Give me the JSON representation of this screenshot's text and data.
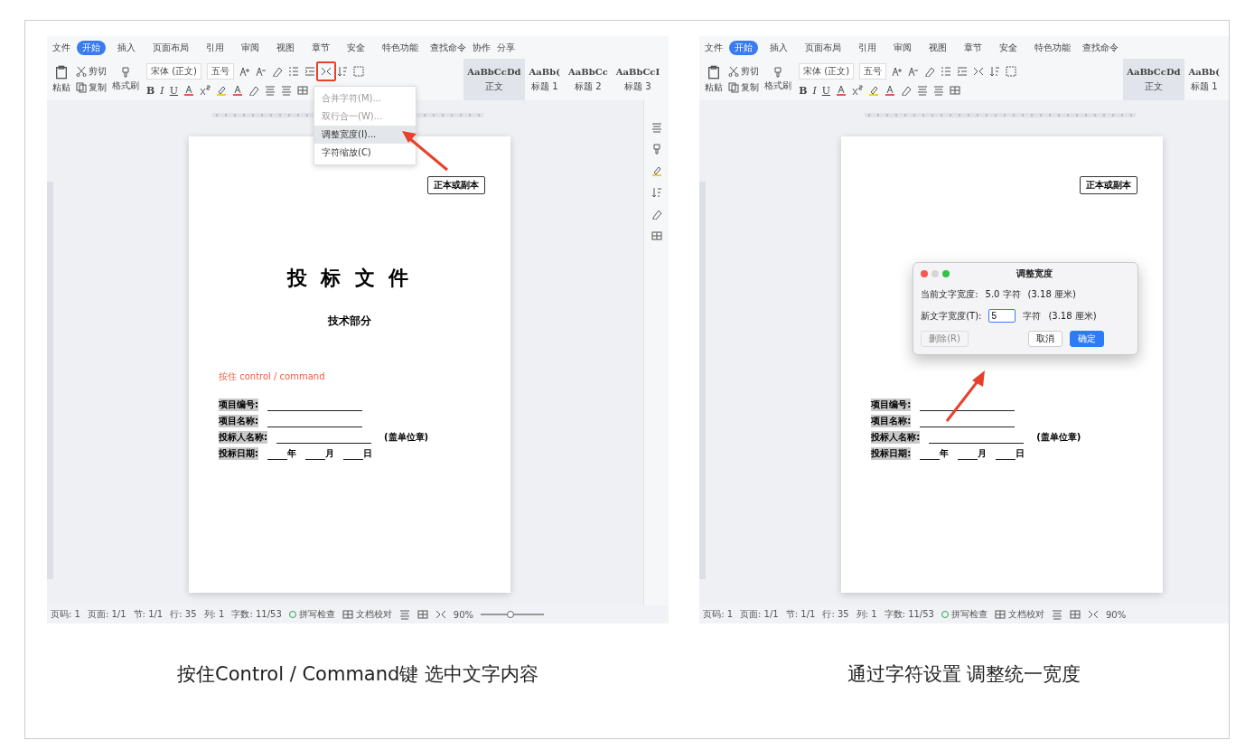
{
  "panels": [
    {
      "menu": {
        "file": "文件",
        "tabs": [
          {
            "label": "开始",
            "selected": true
          },
          {
            "label": "插入",
            "selected": false
          },
          {
            "label": "页面布局",
            "selected": false
          },
          {
            "label": "引用",
            "selected": false
          },
          {
            "label": "审阅",
            "selected": false
          },
          {
            "label": "视图",
            "selected": false
          },
          {
            "label": "章节",
            "selected": false
          },
          {
            "label": "安全",
            "selected": false
          },
          {
            "label": "特色功能",
            "selected": false
          }
        ],
        "extras": [
          "查找命令",
          "协作",
          "分享"
        ]
      },
      "toolbar": {
        "clipboard": [
          "粘贴",
          "剪切",
          "复制",
          "格式刷"
        ],
        "font_name": "宋体 (正文)",
        "font_size": "五号",
        "format": [
          "B",
          "I",
          "U"
        ],
        "highlighted_tool": true,
        "styles": [
          {
            "preview": "AaBbCcDd",
            "label": "正文",
            "selected": true
          },
          {
            "preview": "AaBb(",
            "label": "标题 1",
            "selected": false
          },
          {
            "preview": "AaBbCc",
            "label": "标题 2",
            "selected": false
          },
          {
            "preview": "AaBbCcI",
            "label": "标题 3",
            "selected": false
          }
        ]
      },
      "side_toolbar": true,
      "document": {
        "badge": "正本或副本",
        "title": "投 标 文 件",
        "subtitle": "技术部分",
        "note": "按住 control / command",
        "fields": [
          {
            "label": "项目编号:",
            "highlighted": true,
            "kind": "line"
          },
          {
            "label": "项目名称:",
            "highlighted": true,
            "kind": "line"
          },
          {
            "label": "投标人名称:",
            "highlighted": true,
            "kind": "line",
            "suffix": "(盖单位章)"
          },
          {
            "label": "投标日期:",
            "highlighted": true,
            "kind": "date",
            "parts": [
              "年",
              "月",
              "日"
            ]
          }
        ]
      },
      "status_bar": {
        "items": [
          "页码: 1",
          "页面: 1/1",
          "节: 1/1",
          "行: 35",
          "列: 1",
          "字数: 11/53"
        ],
        "spell_check": "拼写检查",
        "proofread": "文档校对",
        "zoom": "90%",
        "zoom_slider": {
          "level": 0.45
        }
      },
      "dropdown": {
        "items": [
          {
            "label": "合并字符(M)...",
            "disabled": true,
            "selected": false
          },
          {
            "label": "双行合一(W)...",
            "disabled": true,
            "selected": false
          },
          {
            "label": "调整宽度(I)...",
            "disabled": false,
            "selected": true
          },
          {
            "label": "字符缩放(C)",
            "disabled": false,
            "selected": false
          }
        ]
      },
      "caption": "按住Control / Command键 选中文字内容"
    },
    {
      "menu": {
        "file": "文件",
        "tabs": [
          {
            "label": "开始",
            "selected": true
          },
          {
            "label": "插入",
            "selected": false
          },
          {
            "label": "页面布局",
            "selected": false
          },
          {
            "label": "引用",
            "selected": false
          },
          {
            "label": "审阅",
            "selected": false
          },
          {
            "label": "视图",
            "selected": false
          },
          {
            "label": "章节",
            "selected": false
          },
          {
            "label": "安全",
            "selected": false
          },
          {
            "label": "特色功能",
            "selected": false
          }
        ],
        "extras": [
          "查找命令"
        ]
      },
      "toolbar": {
        "clipboard": [
          "粘贴",
          "剪切",
          "复制",
          "格式刷"
        ],
        "font_name": "宋体 (正文)",
        "font_size": "五号",
        "format": [
          "B",
          "I",
          "U"
        ],
        "styles": [
          {
            "preview": "AaBbCcDd",
            "label": "正文",
            "selected": true
          },
          {
            "preview": "AaBb(",
            "label": "标题 1",
            "selected": false
          }
        ]
      },
      "document": {
        "badge": "正本或副本",
        "fields": [
          {
            "label": "项目编号:",
            "highlighted": true,
            "kind": "line"
          },
          {
            "label": "项目名称:",
            "highlighted": true,
            "kind": "line"
          },
          {
            "label": "投标人名称:",
            "highlighted": true,
            "kind": "line",
            "suffix": "(盖单位章)"
          },
          {
            "label": "投标日期:",
            "highlighted": true,
            "kind": "date",
            "parts": [
              "年",
              "月",
              "日"
            ]
          }
        ]
      },
      "status_bar": {
        "items": [
          "页码: 1",
          "页面: 1/1",
          "节: 1/1",
          "行: 35",
          "列: 1",
          "字数: 11/53"
        ],
        "spell_check": "拼写检查",
        "proofread": "文档校对",
        "zoom": "90%"
      },
      "dialog": {
        "title": "调整宽度",
        "current_label": "当前文字宽度:",
        "current_value": "5.0 字符",
        "current_cm": "(3.18 厘米)",
        "new_label": "新文字宽度(T):",
        "new_value": "5",
        "unit": "字符",
        "new_cm": "(3.18 厘米)",
        "buttons": [
          {
            "label": "删除(R)",
            "kind": "disabled"
          },
          {
            "label": "取消",
            "kind": "normal"
          },
          {
            "label": "确定",
            "kind": "primary"
          }
        ]
      },
      "caption": "通过字符设置 调整统一宽度"
    }
  ]
}
